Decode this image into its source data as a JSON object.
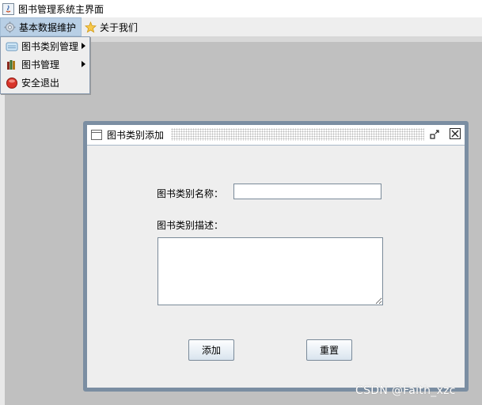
{
  "window": {
    "title": "图书管理系统主界面",
    "icon": "java-app-icon"
  },
  "menubar": {
    "items": [
      {
        "label": "基本数据维护",
        "icon": "gear-icon"
      },
      {
        "label": "关于我们",
        "icon": "star-icon"
      }
    ]
  },
  "dropdown": {
    "items": [
      {
        "label": "图书类别管理",
        "icon": "category-icon",
        "has_submenu": true
      },
      {
        "label": "图书管理",
        "icon": "books-icon",
        "has_submenu": true
      },
      {
        "label": "安全退出",
        "icon": "exit-icon",
        "has_submenu": false
      }
    ]
  },
  "internal_frame": {
    "title": "图书类别添加",
    "form": {
      "name_label": "图书类别名称：",
      "name_value": "",
      "desc_label": "图书类别描述：",
      "desc_value": ""
    },
    "buttons": {
      "add": "添加",
      "reset": "重置"
    }
  },
  "watermark": "CSDN @Faith_xzc",
  "colors": {
    "desktop": "#c0c0c0",
    "frame_border": "#7b8ea2",
    "menu_active": "#b8cfe5"
  }
}
